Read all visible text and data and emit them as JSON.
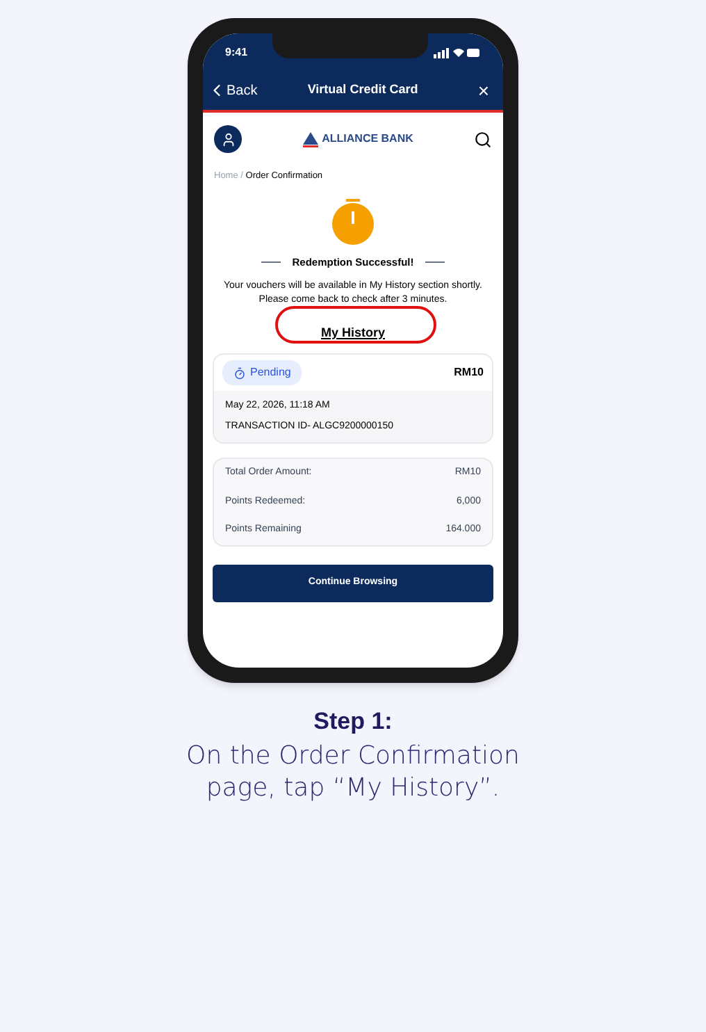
{
  "status_bar": {
    "time": "9:41"
  },
  "header": {
    "back": "Back",
    "title": "Virtual Credit Card",
    "close": "×"
  },
  "bank": {
    "name": "ALLIANCE BANK"
  },
  "breadcrumb": {
    "home": "Home",
    "separator": "/",
    "current": "Order Confirmation"
  },
  "result": {
    "title": "Redemption Successful!",
    "message": "Your vouchers will be available in My History section shortly. Please come back to check after 3 minutes.",
    "link": "My History",
    "highlighted": true
  },
  "order": {
    "status": "Pending",
    "amount": "RM10",
    "date": "May 22, 2026, 11:18 AM",
    "transaction": "TRANSACTION ID- ALGC9200000150"
  },
  "summary": [
    {
      "label": "Total Order Amount:",
      "value": "RM10"
    },
    {
      "label": "Points Redeemed:",
      "value": "6,000"
    },
    {
      "label": "Points Remaining",
      "value": "164.000"
    }
  ],
  "button": "Continue Browsing",
  "caption": {
    "step": "Step 1:",
    "text": "On the Order Confirmation page, tap “My History”."
  }
}
